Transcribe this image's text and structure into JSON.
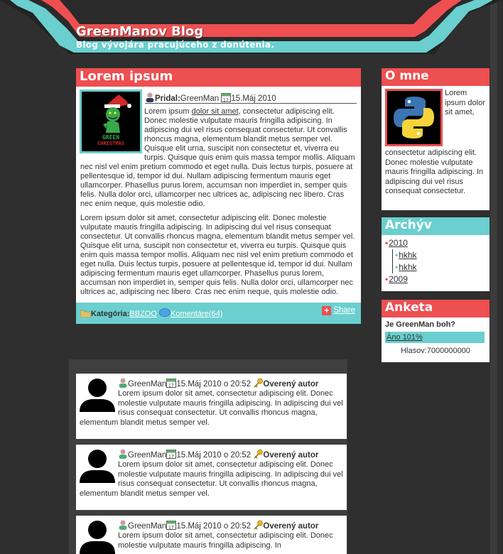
{
  "site": {
    "title": "GreenManov Blog",
    "tagline": "Blog vývojára pracujúceho z donútenia."
  },
  "colors": {
    "red": "#ee4f51",
    "cyan": "#6bcfcf",
    "background": "#2f2f2f"
  },
  "post": {
    "title": "Lorem ipsum",
    "author_label": "Pridal:",
    "author": "GreenMan",
    "date": "15.Máj 2010",
    "thumb_text_1": "GREEN",
    "thumb_text_2": "CHRISTMAS",
    "p1_start": "Lorem ipsum ",
    "p1_link": "dolor sit amet",
    "p1_rest": ", consectetur adipiscing elit. Donec molestie vulputate mauris fringilla adipiscing. In adipiscing dui vel risus consequat consectetur. Ut convallis rhoncus magna, elementum blandit metus semper vel. Quisque elit urna, suscipit non consectetur et, viverra eu turpis. Quisque quis enim quis massa tempor mollis. Aliquam nec nisl vel enim pretium commodo et eget nulla. Duis lectus turpis, posuere at pellentesque id, tempor id dui. Nullam adipiscing fermentum mauris eget ullamcorper. Phasellus purus lorem, accumsan non imperdiet in, semper quis felis. Nulla dolor orci, ullamcorper nec ultrices ac, adipiscing nec libero. Cras nec enim neque, quis molestie odio.",
    "p2": "Lorem ipsum dolor sit amet, consectetur adipiscing elit. Donec molestie vulputate mauris fringilla adipiscing. In adipiscing dui vel risus consequat consectetur. Ut convallis rhoncus magna, elementum blandit metus semper vel. Quisque elit urna, suscipit non consectetur et, viverra eu turpis. Quisque quis enim quis massa tempor mollis. Aliquam nec nisl vel enim pretium commodo et eget nulla. Duis lectus turpis, posuere at pellentesque id, tempor id dui. Nullam adipiscing fermentum mauris eget ullamcorper. Phasellus purus lorem, accumsan non imperdiet in, semper quis felis. Nulla dolor orci, ullamcorper nec ultrices ac, adipiscing nec libero. Cras nec enim neque, quis molestie odio.",
    "category_label": "Kategória:",
    "category": "BBZOO",
    "comments": "Komentáre(64)",
    "share": "Share"
  },
  "comments": [
    {
      "author": "GreenMan",
      "date": "15.Máj 2010 o 20:52",
      "badge": "Overený autor",
      "text": "Lorem ipsum dolor sit amet, consectetur adipiscing elit. Donec molestie vulputate mauris fringilla adipiscing. In adipiscing dui vel risus consequat consectetur. Ut convallis rhoncus magna, elementum blandit metus semper vel."
    },
    {
      "author": "GreenMan",
      "date": "15.Máj 2010 o 20:52",
      "badge": "Overený autor",
      "text": "Lorem ipsum dolor sit amet, consectetur adipiscing elit. Donec molestie vulputate mauris fringilla adipiscing. In adipiscing dui vel risus consequat consectetur. Ut convallis rhoncus magna, elementum blandit metus semper vel."
    },
    {
      "author": "GreenMan",
      "date": "15.Máj 2010 o 20:52",
      "badge": "Overený autor",
      "text": "Lorem ipsum dolor sit amet, consectetur adipiscing elit. Donec molestie vulputate mauris fringilla adipiscing. In"
    }
  ],
  "sidebar": {
    "about": {
      "title": "O mne",
      "text_beside": "Lorem ipsum dolor sit amet,",
      "text_below": "consectetur adipiscing elit. Donec molestie vulputate mauris fringilla adipiscing. In adipiscing dui vel risus consequat consectetur."
    },
    "archive": {
      "title": "Archýv",
      "years": [
        {
          "label": "2010",
          "items": [
            "hkhk",
            "hkhk"
          ]
        },
        {
          "label": "2009",
          "items": []
        }
      ]
    },
    "poll": {
      "title": "Anketa",
      "question": "Je GreenMan boh?",
      "answer": "Áno 101%",
      "answer_percent": 101,
      "votes": "Hlasov:7000000000"
    }
  }
}
